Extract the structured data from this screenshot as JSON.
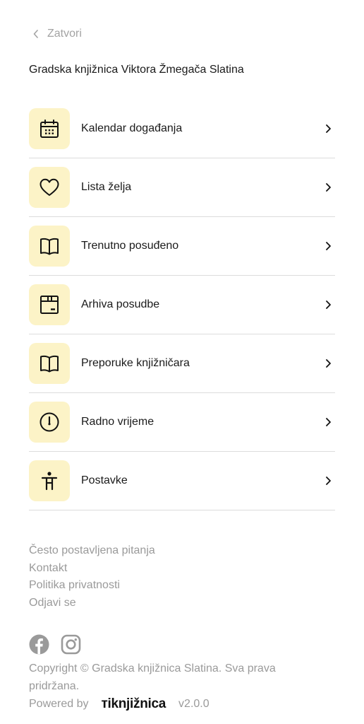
{
  "header": {
    "back_label": "Zatvori",
    "library_name": "Gradska knjižnica Viktora Žmegača Slatina"
  },
  "menu": {
    "items": [
      {
        "label": "Kalendar događanja",
        "icon": "calendar-icon"
      },
      {
        "label": "Lista želja",
        "icon": "heart-icon"
      },
      {
        "label": "Trenutno posuđeno",
        "icon": "open-book-icon"
      },
      {
        "label": "Arhiva posudbe",
        "icon": "archive-box-icon"
      },
      {
        "label": "Preporuke knjižničara",
        "icon": "open-book-icon"
      },
      {
        "label": "Radno vrijeme",
        "icon": "clock-icon"
      },
      {
        "label": "Postavke",
        "icon": "accessibility-icon"
      }
    ]
  },
  "footer_links": {
    "faq": "Često postavljena pitanja",
    "contact": "Kontakt",
    "privacy": "Politika privatnosti",
    "logout": "Odjavi se"
  },
  "social": {
    "icons": [
      "facebook-icon",
      "instagram-icon"
    ]
  },
  "footer": {
    "copyright": "Copyright © Gradska knjižnica Slatina. Sva prava pridržana.",
    "powered_by": "Powered by",
    "brand_mark": "ті",
    "brand_name": "knjižnica",
    "version": "v2.0.0"
  },
  "colors": {
    "icon_bg": "#fcf3c7",
    "muted_text": "#9a9a9a",
    "divider": "#dcdcdc"
  }
}
